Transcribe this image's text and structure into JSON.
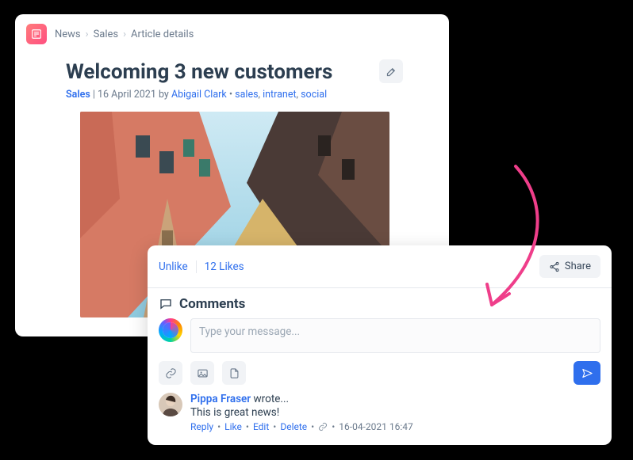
{
  "breadcrumbs": {
    "items": [
      "News",
      "Sales"
    ],
    "current": "Article details"
  },
  "article": {
    "title": "Welcoming 3 new customers",
    "category": "Sales",
    "date": "16 April 2021",
    "by_word": "by",
    "author": "Abigail Clark",
    "tags": [
      "sales",
      "intranet",
      "social"
    ],
    "edit_aria": "Edit"
  },
  "engagement": {
    "unlike_label": "Unlike",
    "likes_label": "12 Likes",
    "share_label": "Share"
  },
  "comments": {
    "heading": "Comments",
    "placeholder": "Type your message...",
    "send_aria": "Send",
    "tools": {
      "link": "Link",
      "image": "Image",
      "file": "File"
    },
    "existing": {
      "author": "Pippa Fraser",
      "wrote_word": "wrote...",
      "text": "This is great news!",
      "actions": {
        "reply": "Reply",
        "like": "Like",
        "edit": "Edit",
        "delete": "Delete"
      },
      "timestamp": "16-04-2021 16:47"
    }
  }
}
